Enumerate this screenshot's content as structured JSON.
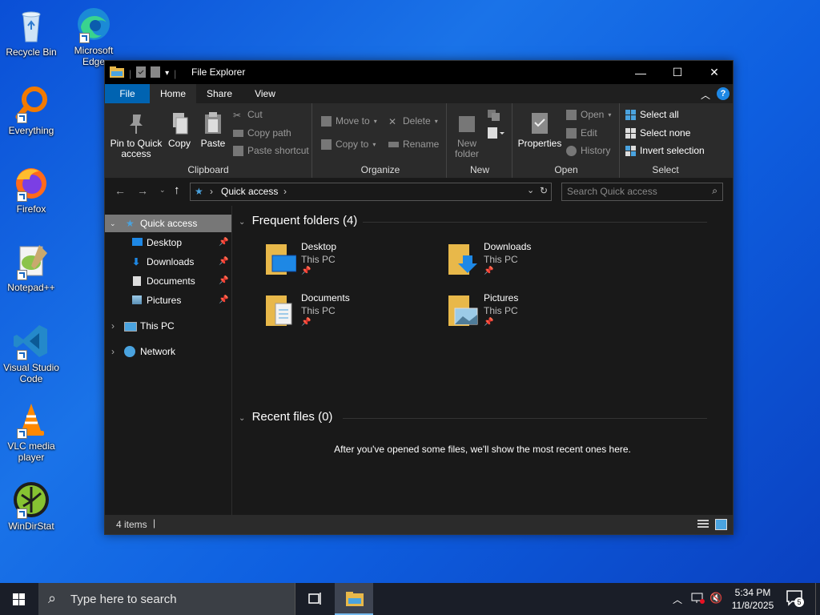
{
  "desktop": {
    "icons": [
      {
        "label": "Recycle Bin",
        "icon": "recycle-bin-icon"
      },
      {
        "label": "Microsoft Edge",
        "icon": "edge-icon"
      },
      {
        "label": "Everything",
        "icon": "everything-icon"
      },
      {
        "label": "Firefox",
        "icon": "firefox-icon"
      },
      {
        "label": "Notepad++",
        "icon": "notepadpp-icon"
      },
      {
        "label": "Visual Studio Code",
        "icon": "vscode-icon"
      },
      {
        "label": "VLC media player",
        "icon": "vlc-icon"
      },
      {
        "label": "WinDirStat",
        "icon": "windirstat-icon"
      }
    ]
  },
  "window": {
    "title": "File Explorer",
    "minimize": "—",
    "maximize": "☐",
    "close": "✕",
    "help": "?",
    "tabs": [
      "File",
      "Home",
      "Share",
      "View"
    ],
    "active_tab": "Home",
    "accent": "#0063b1"
  },
  "ribbon": {
    "clipboard": {
      "pin_line1": "Pin to Quick",
      "pin_line2": "access",
      "copy": "Copy",
      "paste": "Paste",
      "cut": "Cut",
      "copy_path": "Copy path",
      "paste_shortcut": "Paste shortcut",
      "label": "Clipboard"
    },
    "organize": {
      "move_to": "Move to",
      "copy_to": "Copy to",
      "delete": "Delete",
      "rename": "Rename",
      "label": "Organize"
    },
    "new": {
      "new_line1": "New",
      "new_line2": "folder",
      "label": "New"
    },
    "open": {
      "properties": "Properties",
      "open": "Open",
      "edit": "Edit",
      "history": "History",
      "label": "Open"
    },
    "select": {
      "select_all": "Select all",
      "select_none": "Select none",
      "invert": "Invert selection",
      "label": "Select"
    }
  },
  "address": {
    "path": "Quick access",
    "search_placeholder": "Search Quick access"
  },
  "nav": {
    "quick_access": "Quick access",
    "pinned": [
      "Desktop",
      "Downloads",
      "Documents",
      "Pictures"
    ],
    "this_pc": "This PC",
    "network": "Network"
  },
  "content": {
    "frequent_header": "Frequent folders (4)",
    "folders": [
      {
        "name": "Desktop",
        "location": "This PC",
        "icon": "desktop-folder-icon"
      },
      {
        "name": "Downloads",
        "location": "This PC",
        "icon": "downloads-folder-icon"
      },
      {
        "name": "Documents",
        "location": "This PC",
        "icon": "documents-folder-icon"
      },
      {
        "name": "Pictures",
        "location": "This PC",
        "icon": "pictures-folder-icon"
      }
    ],
    "recent_header": "Recent files (0)",
    "recent_empty": "After you've opened some files, we'll show the most recent ones here."
  },
  "status": {
    "items": "4 items"
  },
  "taskbar": {
    "search_placeholder": "Type here to search",
    "time": "5:34 PM",
    "date": "11/8/2025",
    "notifications": "5"
  }
}
